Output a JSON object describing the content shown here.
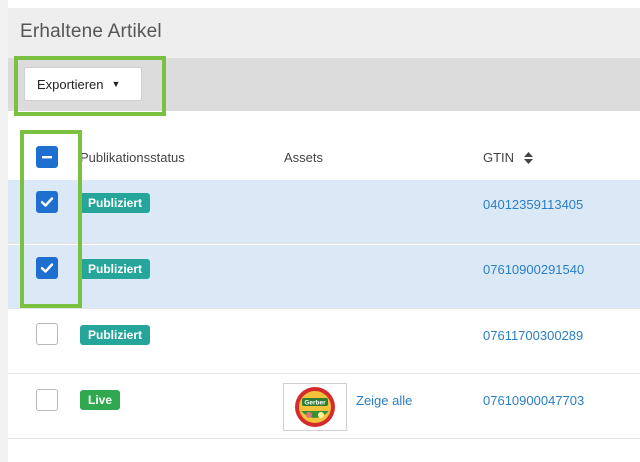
{
  "header": {
    "title": "Erhaltene Artikel"
  },
  "toolbar": {
    "export_label": "Exportieren",
    "export_caret": "▼"
  },
  "table": {
    "columns": {
      "status": "Publikationsstatus",
      "assets": "Assets",
      "gtin": "GTIN"
    },
    "rows": [
      {
        "checked": true,
        "status": "Publiziert",
        "status_color": "#26a69a",
        "gtin": "04012359113405",
        "assets": ""
      },
      {
        "checked": true,
        "status": "Publiziert",
        "status_color": "#26a69a",
        "gtin": "07610900291540",
        "assets": ""
      },
      {
        "checked": false,
        "status": "Publiziert",
        "status_color": "#26a69a",
        "gtin": "07611700300289",
        "assets": ""
      },
      {
        "checked": false,
        "status": "Live",
        "status_color": "#2fa84f",
        "gtin": "07610900047703",
        "assets": "Zeige alle",
        "thumbnail_label": "Gerber"
      }
    ]
  },
  "colors": {
    "selected_row": "#dbe9f7",
    "checkbox_blue": "#1f6fd1",
    "link": "#2a7ec6",
    "highlight_green": "#7ac143"
  },
  "icons": {
    "export_caret": "caret-down-icon",
    "sort": "sort-icon",
    "select_all": "indeterminate-checkbox-icon",
    "check": "checkmark-icon"
  }
}
